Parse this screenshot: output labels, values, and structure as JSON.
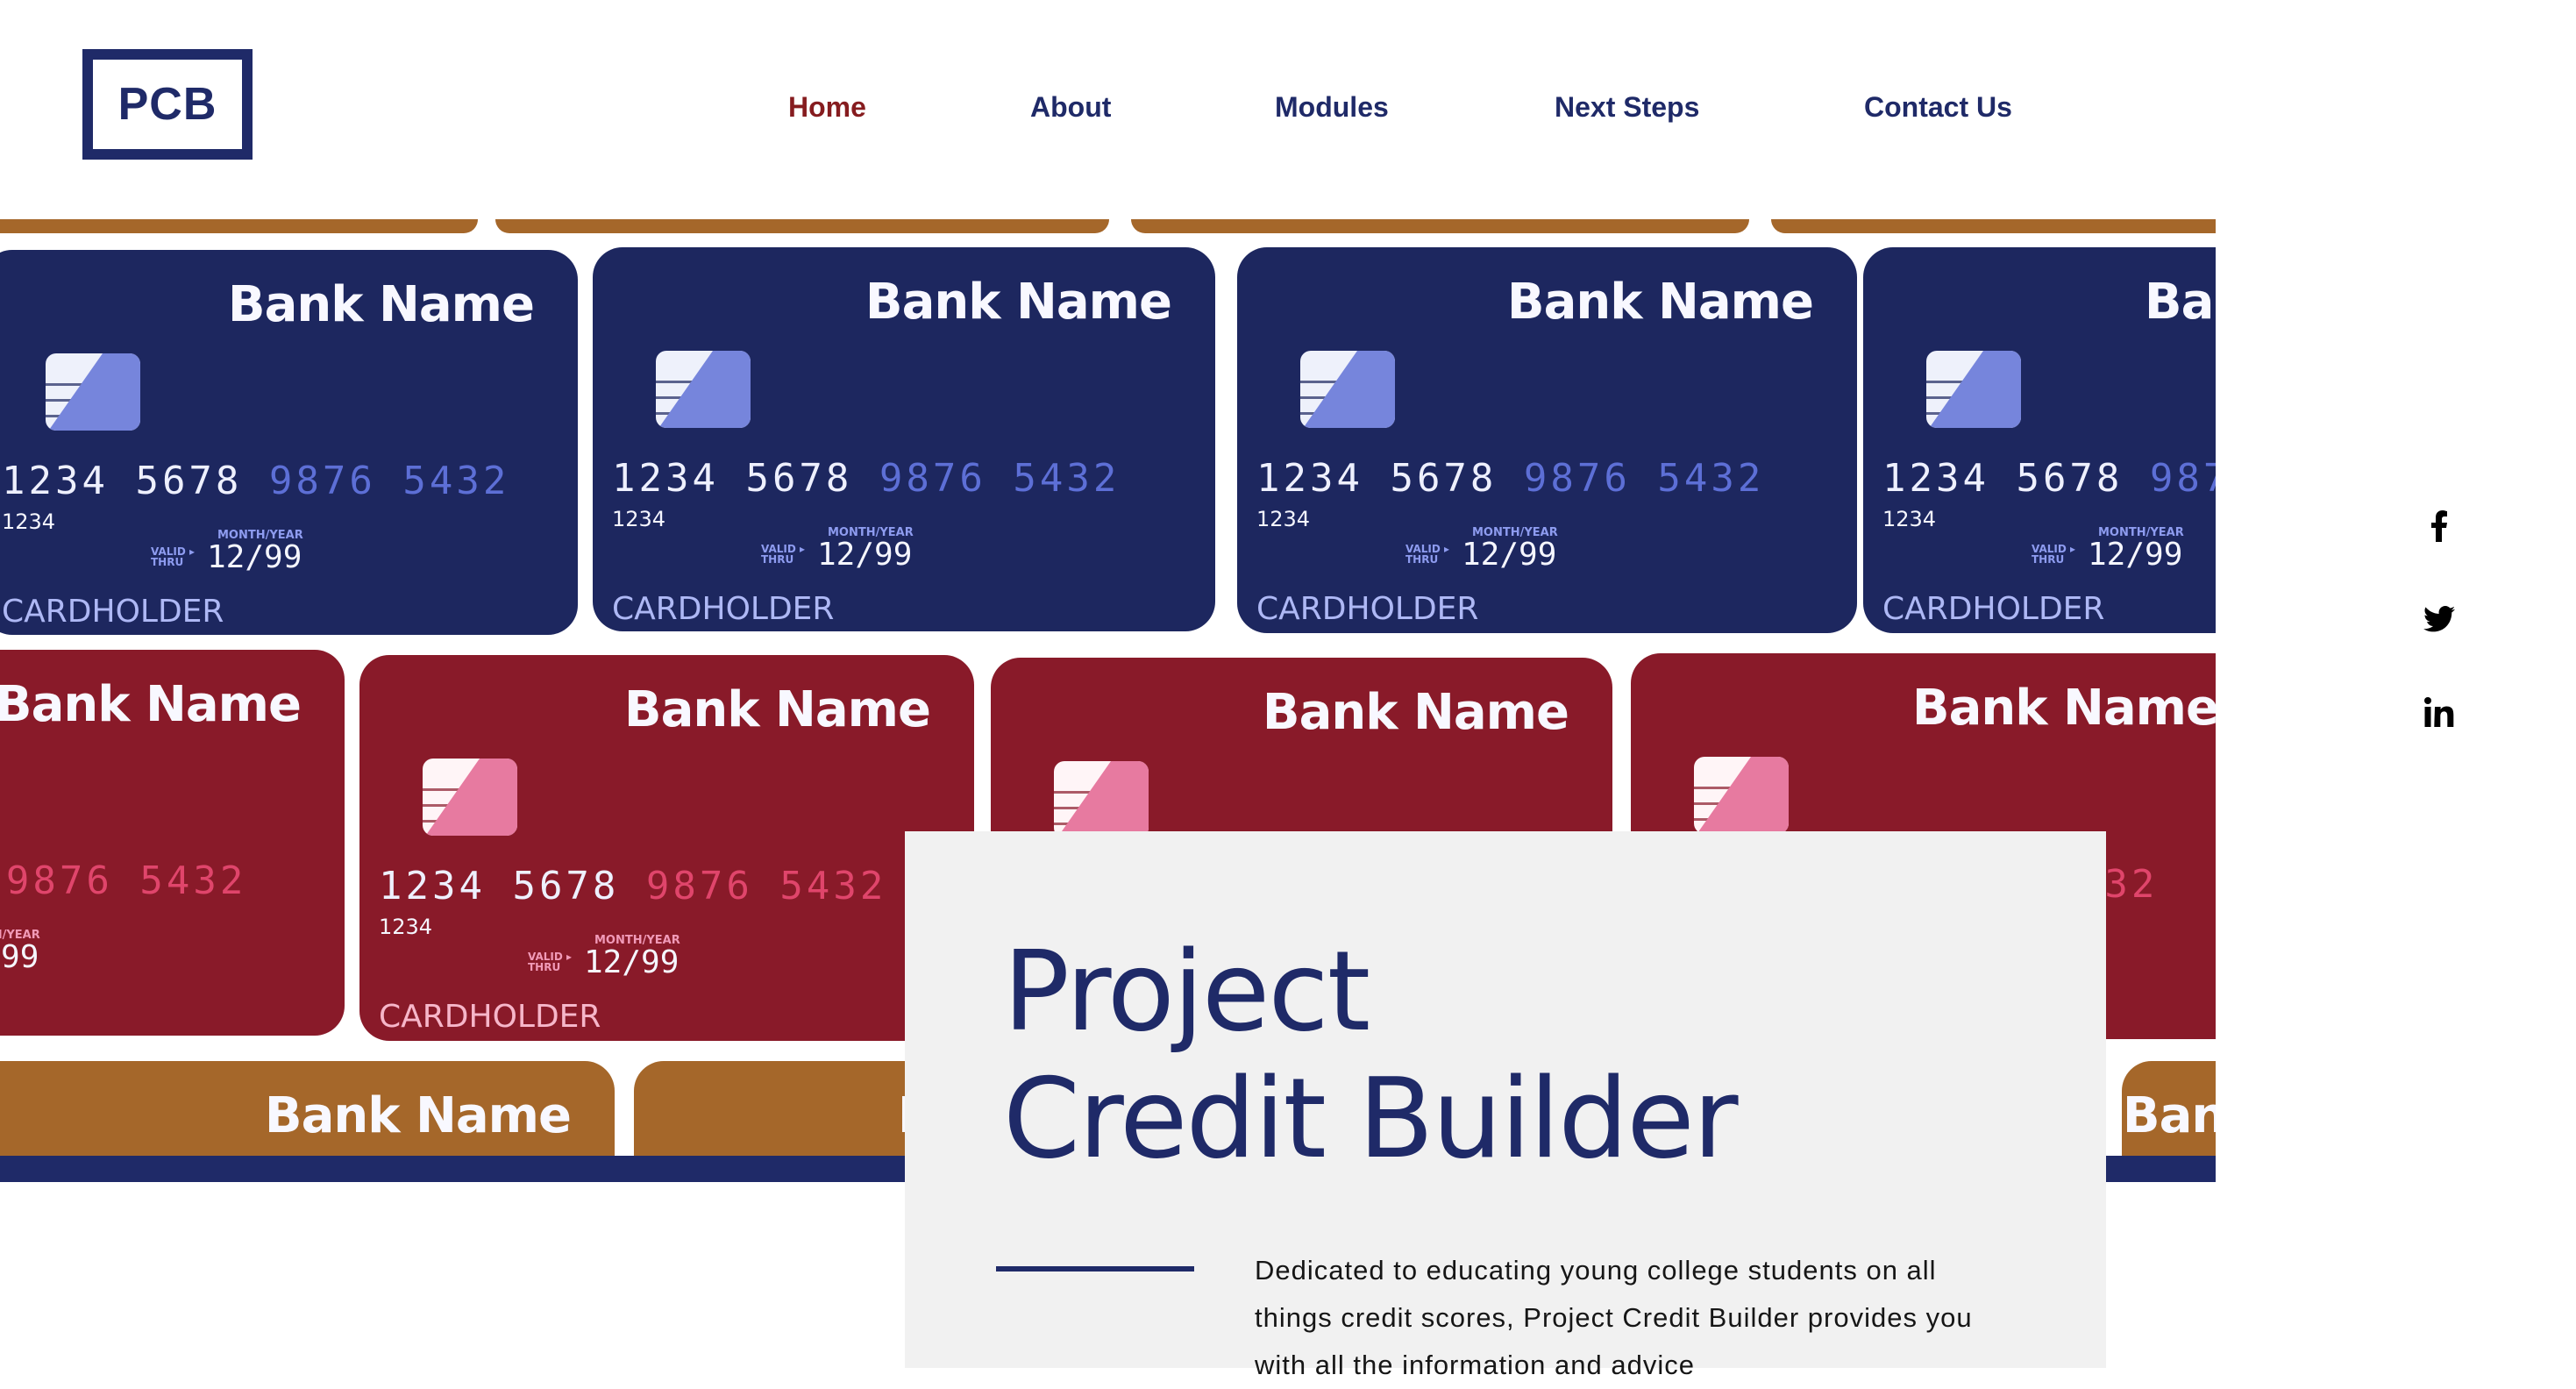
{
  "header": {
    "logo_text": "PCB",
    "nav": [
      {
        "label": "Home",
        "active": true
      },
      {
        "label": "About",
        "active": false
      },
      {
        "label": "Modules",
        "active": false
      },
      {
        "label": "Next Steps",
        "active": false
      },
      {
        "label": "Contact Us",
        "active": false
      }
    ]
  },
  "hero_image": {
    "description": "Wall of sample credit cards in navy, red and gold",
    "card": {
      "bank_name": "Bank Name",
      "number_bright": "1234 5678",
      "number_dim": " 9876 5432",
      "sub_number": "1234",
      "month_year_label": "MONTH/YEAR",
      "valid_thru_label_1": "VALID",
      "valid_thru_label_2": "THRU",
      "expiry": "12/99",
      "cardholder": "CARDHOLDER"
    }
  },
  "intro": {
    "title_line_1": "Project",
    "title_line_2": "Credit Builder",
    "description": "Dedicated to educating young college students on all things credit scores, Project Credit Builder provides you with all the information and advice"
  },
  "social": [
    {
      "icon": "facebook-icon",
      "label": "Facebook"
    },
    {
      "icon": "twitter-icon",
      "label": "Twitter"
    },
    {
      "icon": "linkedin-icon",
      "label": "LinkedIn"
    }
  ],
  "colors": {
    "brand_navy": "#1f2a68",
    "active_nav": "#861c1f",
    "card_navy": "#1d275f",
    "card_red": "#891a29",
    "card_gold": "#a5672a",
    "panel_bg": "#f1f1f1"
  }
}
